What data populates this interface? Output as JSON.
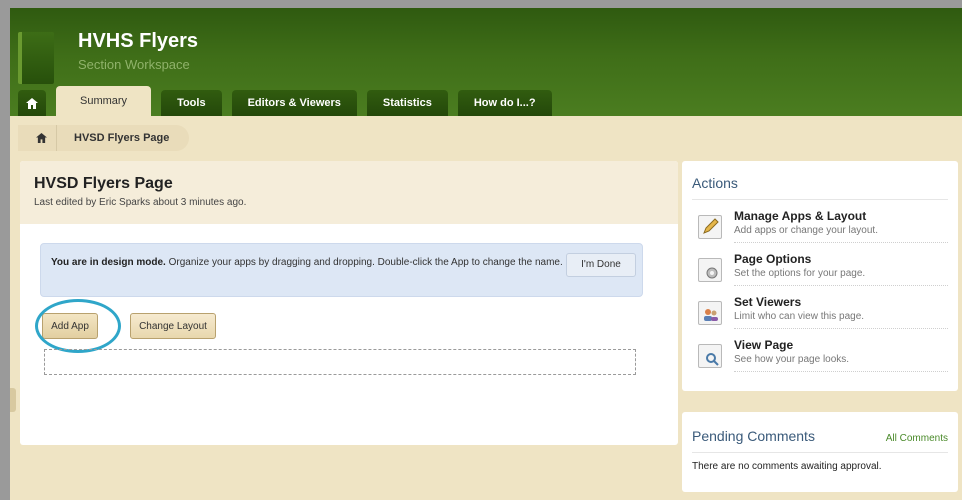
{
  "header": {
    "title": "HVHS Flyers",
    "subtitle": "Section Workspace"
  },
  "tabs": [
    {
      "label": "Summary"
    },
    {
      "label": "Tools"
    },
    {
      "label": "Editors & Viewers"
    },
    {
      "label": "Statistics"
    },
    {
      "label": "How do I...?"
    }
  ],
  "breadcrumb": {
    "page": "HVSD Flyers Page"
  },
  "main": {
    "title": "HVSD Flyers Page",
    "meta": "Last edited by Eric Sparks about 3 minutes ago.",
    "notice_bold": "You are in design mode.",
    "notice_text": " Organize your apps by dragging and dropping. Double-click the App to change the name.",
    "done_label": "I'm Done",
    "add_app_label": "Add App",
    "change_layout_label": "Change Layout"
  },
  "actions": {
    "title": "Actions",
    "items": [
      {
        "label": "Manage Apps & Layout",
        "desc": "Add apps or change your layout.",
        "icon": "pencil-icon"
      },
      {
        "label": "Page Options",
        "desc": "Set the options for your page.",
        "icon": "gear-page-icon"
      },
      {
        "label": "Set Viewers",
        "desc": "Limit who can view this page.",
        "icon": "people-icon"
      },
      {
        "label": "View Page",
        "desc": "See how your page looks.",
        "icon": "magnifier-page-icon"
      }
    ]
  },
  "pending": {
    "title": "Pending Comments",
    "link": "All Comments",
    "empty": "There are no comments awaiting approval."
  },
  "colors": {
    "header_green": "#3f6e18",
    "highlight_ring": "#2fa6c9",
    "panel_title": "#3a5a7a"
  }
}
